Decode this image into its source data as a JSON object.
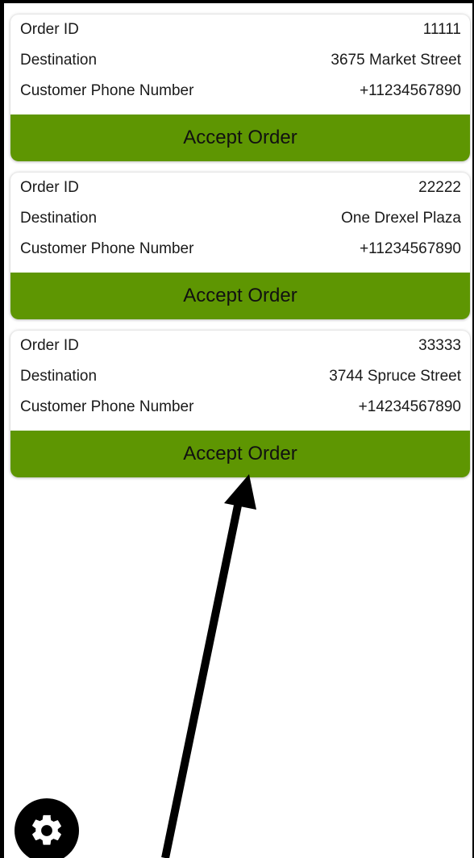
{
  "orders": [
    {
      "rows": [
        {
          "label": "Order ID",
          "value": "11111"
        },
        {
          "label": "Destination",
          "value": "3675 Market Street"
        },
        {
          "label": "Customer Phone Number",
          "value": "+11234567890"
        }
      ],
      "button": "Accept Order"
    },
    {
      "rows": [
        {
          "label": "Order ID",
          "value": "22222"
        },
        {
          "label": "Destination",
          "value": "One Drexel Plaza"
        },
        {
          "label": "Customer Phone Number",
          "value": "+11234567890"
        }
      ],
      "button": "Accept Order"
    },
    {
      "rows": [
        {
          "label": "Order ID",
          "value": "33333"
        },
        {
          "label": "Destination",
          "value": "3744 Spruce Street"
        },
        {
          "label": "Customer Phone Number",
          "value": "+14234567890"
        }
      ],
      "button": "Accept Order"
    }
  ],
  "colors": {
    "accept_button": "#5e9602",
    "settings_button": "#000000"
  },
  "icons": {
    "settings": "gear-icon",
    "annotation": "arrow-pointer"
  }
}
